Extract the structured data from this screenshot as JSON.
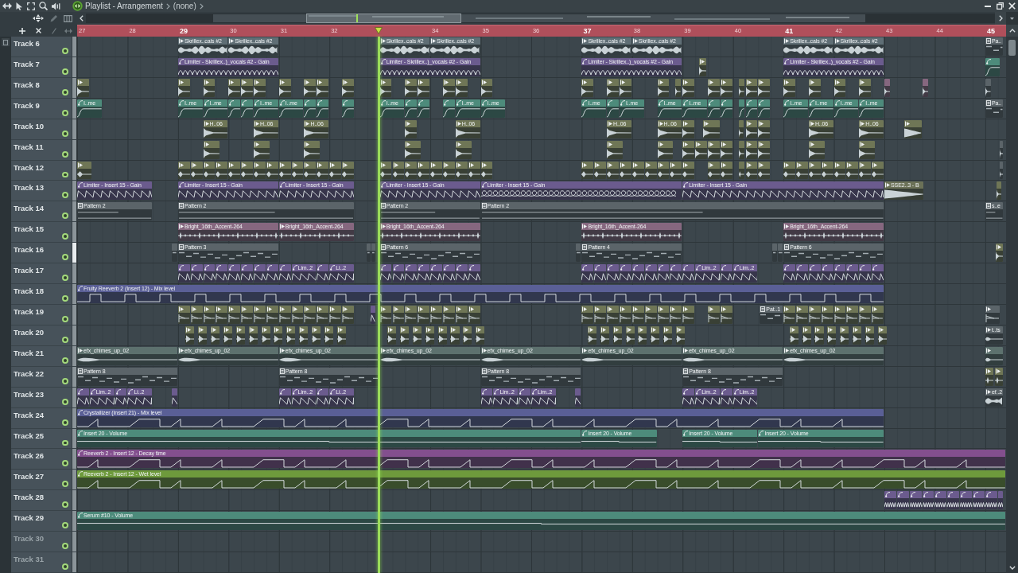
{
  "window": {
    "title": "Playlist - Arrangement",
    "pattern": "(none)"
  },
  "ruler": [
    {
      "label": "27",
      "major": false
    },
    {
      "label": "28",
      "major": false
    },
    {
      "label": "29",
      "major": true
    },
    {
      "label": "30",
      "major": false
    },
    {
      "label": "31",
      "major": false
    },
    {
      "label": "32",
      "major": false
    },
    {
      "label": "34",
      "major": false
    },
    {
      "label": "35",
      "major": false
    },
    {
      "label": "36",
      "major": false
    },
    {
      "label": "37",
      "major": true
    },
    {
      "label": "38",
      "major": false
    },
    {
      "label": "39",
      "major": false
    },
    {
      "label": "40",
      "major": false
    },
    {
      "label": "41",
      "major": true
    },
    {
      "label": "42",
      "major": false
    },
    {
      "label": "43",
      "major": false
    },
    {
      "label": "44",
      "major": false
    },
    {
      "label": "45",
      "major": true
    }
  ],
  "tracks": [
    {
      "name": "Track 6",
      "enabled": true,
      "selected": false,
      "dimmed": false,
      "color": "#5f6e75",
      "clips": [
        {
          "kind": "audio",
          "label": "Skrillex..cals #2"
        },
        {
          "kind": "audio",
          "label": "Skrillex..cals #2"
        },
        {
          "kind": "audio",
          "label": "Skrillex..cals #2"
        },
        {
          "kind": "audio",
          "label": "Skrillex..cals #2"
        },
        {
          "kind": "audio",
          "label": "Skrillex..cals #2"
        },
        {
          "kind": "audio",
          "label": "Skrillex..cals #2"
        },
        {
          "kind": "audio",
          "label": "Skrillex..cals #2"
        },
        {
          "kind": "audio",
          "label": "Skrillex..cals #2"
        },
        {
          "kind": "pattern",
          "label": "Pa..",
          "color": "#5b6469"
        }
      ]
    },
    {
      "name": "Track 7",
      "enabled": true,
      "selected": false,
      "dimmed": false,
      "color": "#6b5b8e",
      "clips": [
        {
          "kind": "automation",
          "label": "Limiter - Skrillex..)_vocals #2 - Gain"
        },
        {
          "kind": "automation",
          "label": "Limiter - Skrillex..)_vocals #2 - Gain"
        },
        {
          "kind": "automation",
          "label": "Limiter - Skrillex..)_vocals #2 - Gain"
        },
        {
          "kind": "audio",
          "color": "#6f7656"
        },
        {
          "kind": "automation",
          "label": "Limiter - Skrillex..)_vocals #2 - Gain"
        },
        {
          "kind": "automation",
          "color": "#4d8b7b"
        }
      ]
    },
    {
      "name": "Track 8",
      "enabled": true,
      "selected": false,
      "dimmed": false,
      "color": "#6f7656",
      "clips": [
        {
          "kind": "audio"
        },
        {
          "kind": "audio"
        },
        {
          "kind": "audio"
        },
        {
          "kind": "audio"
        },
        {
          "kind": "audio"
        },
        {
          "kind": "audio"
        },
        {
          "kind": "audio"
        },
        {
          "kind": "audio"
        },
        {
          "kind": "audio"
        },
        {
          "kind": "audio"
        },
        {
          "kind": "audio"
        },
        {
          "kind": "audio"
        },
        {
          "kind": "audio"
        },
        {
          "kind": "audio"
        },
        {
          "kind": "audio"
        },
        {
          "kind": "audio"
        },
        {
          "kind": "audio"
        },
        {
          "kind": "audio"
        },
        {
          "kind": "audio"
        },
        {
          "kind": "audio"
        },
        {
          "kind": "audio"
        },
        {
          "kind": "audio"
        },
        {
          "kind": "audio"
        },
        {
          "kind": "audio"
        },
        {
          "kind": "audio"
        },
        {
          "kind": "audio"
        },
        {
          "kind": "audio"
        },
        {
          "kind": "audio"
        },
        {
          "kind": "audio"
        },
        {
          "kind": "audio"
        },
        {
          "kind": "audio"
        },
        {
          "kind": "audio",
          "color": "#86677f"
        },
        {
          "kind": "audio",
          "color": "#86677f"
        },
        {
          "kind": "audio",
          "color": "#5b6469"
        }
      ]
    },
    {
      "name": "Track 9",
      "enabled": true,
      "selected": false,
      "dimmed": false,
      "color": "#4d8b7b",
      "clips": [
        {
          "kind": "automation",
          "label": "I..me"
        },
        {
          "kind": "automation",
          "label": "I..me"
        },
        {
          "kind": "automation",
          "label": "I..me"
        },
        {
          "kind": "automation"
        },
        {
          "kind": "automation"
        },
        {
          "kind": "automation",
          "label": "I..me"
        },
        {
          "kind": "automation",
          "label": "I..me"
        },
        {
          "kind": "automation"
        },
        {
          "kind": "automation"
        },
        {
          "kind": "automation"
        },
        {
          "kind": "automation",
          "label": "I..me"
        },
        {
          "kind": "automation"
        },
        {
          "kind": "automation"
        },
        {
          "kind": "automation"
        },
        {
          "kind": "automation",
          "label": "I..me"
        },
        {
          "kind": "automation",
          "label": "I..me"
        },
        {
          "kind": "automation",
          "label": "I..me"
        },
        {
          "kind": "automation"
        },
        {
          "kind": "automation",
          "label": "I..me"
        },
        {
          "kind": "automation",
          "label": "I..me"
        },
        {
          "kind": "automation",
          "label": "I..me"
        },
        {
          "kind": "automation"
        },
        {
          "kind": "automation"
        },
        {
          "kind": "automation"
        },
        {
          "kind": "automation"
        },
        {
          "kind": "automation"
        },
        {
          "kind": "automation",
          "label": "I..me"
        },
        {
          "kind": "automation",
          "label": "I..me"
        },
        {
          "kind": "automation",
          "label": "I..me"
        },
        {
          "kind": "automation",
          "label": "I..me"
        },
        {
          "kind": "pattern",
          "label": "Pa..",
          "color": "#5b6469"
        }
      ]
    },
    {
      "name": "Track 10",
      "enabled": true,
      "selected": false,
      "dimmed": false,
      "color": "#6f7656",
      "clips": [
        {
          "kind": "audio",
          "label": "H..06"
        },
        {
          "kind": "audio",
          "label": "H..06"
        },
        {
          "kind": "audio",
          "label": "H..06"
        },
        {
          "kind": "audio"
        },
        {
          "kind": "audio",
          "label": "H..06"
        },
        {
          "kind": "audio",
          "label": "H..06"
        },
        {
          "kind": "audio",
          "label": "H..06"
        },
        {
          "kind": "audio"
        },
        {
          "kind": "audio"
        },
        {
          "kind": "audio"
        },
        {
          "kind": "audio"
        },
        {
          "kind": "audio"
        },
        {
          "kind": "audio",
          "label": "H..06"
        },
        {
          "kind": "audio",
          "label": "H..06"
        },
        {
          "kind": "audio"
        }
      ]
    },
    {
      "name": "Track 11",
      "enabled": true,
      "selected": false,
      "dimmed": false,
      "color": "#6f7656",
      "clips": [
        {
          "kind": "audio"
        },
        {
          "kind": "audio"
        },
        {
          "kind": "audio"
        },
        {
          "kind": "audio"
        },
        {
          "kind": "audio"
        },
        {
          "kind": "audio"
        },
        {
          "kind": "audio"
        },
        {
          "kind": "audio"
        },
        {
          "kind": "audio"
        },
        {
          "kind": "audio"
        },
        {
          "kind": "audio"
        },
        {
          "kind": "audio"
        },
        {
          "kind": "audio"
        },
        {
          "kind": "audio"
        },
        {
          "kind": "audio"
        },
        {
          "kind": "audio"
        },
        {
          "kind": "audio",
          "color": "#5b6469"
        }
      ]
    },
    {
      "name": "Track 12",
      "enabled": true,
      "selected": false,
      "dimmed": false,
      "color": "#6f7656",
      "clips": [
        {
          "kind": "audio"
        },
        {
          "kind": "audio"
        },
        {
          "kind": "audio"
        },
        {
          "kind": "audio"
        },
        {
          "kind": "audio"
        },
        {
          "kind": "audio"
        },
        {
          "kind": "audio"
        },
        {
          "kind": "audio"
        },
        {
          "kind": "audio"
        },
        {
          "kind": "audio"
        },
        {
          "kind": "audio"
        },
        {
          "kind": "audio"
        },
        {
          "kind": "audio"
        },
        {
          "kind": "audio"
        },
        {
          "kind": "audio"
        },
        {
          "kind": "audio"
        },
        {
          "kind": "audio"
        },
        {
          "kind": "audio"
        },
        {
          "kind": "audio"
        },
        {
          "kind": "audio"
        },
        {
          "kind": "audio"
        },
        {
          "kind": "audio"
        },
        {
          "kind": "audio"
        },
        {
          "kind": "audio"
        },
        {
          "kind": "audio"
        },
        {
          "kind": "audio"
        },
        {
          "kind": "audio"
        },
        {
          "kind": "audio"
        },
        {
          "kind": "audio"
        },
        {
          "kind": "audio"
        },
        {
          "kind": "audio"
        },
        {
          "kind": "audio"
        },
        {
          "kind": "audio"
        },
        {
          "kind": "audio"
        },
        {
          "kind": "audio"
        },
        {
          "kind": "audio"
        },
        {
          "kind": "audio"
        },
        {
          "kind": "audio"
        },
        {
          "kind": "audio"
        },
        {
          "kind": "audio"
        },
        {
          "kind": "audio"
        },
        {
          "kind": "audio"
        },
        {
          "kind": "audio"
        },
        {
          "kind": "audio"
        },
        {
          "kind": "audio"
        },
        {
          "kind": "audio"
        },
        {
          "kind": "audio",
          "color": "#5b6469"
        }
      ]
    },
    {
      "name": "Track 13",
      "enabled": true,
      "selected": false,
      "dimmed": false,
      "color": "#6b5b8e",
      "clips": [
        {
          "kind": "automation",
          "label": "Limiter - Insert 15 - Gain"
        },
        {
          "kind": "automation",
          "label": "Limiter - Insert 15 - Gain"
        },
        {
          "kind": "automation",
          "label": "Limiter - Insert 15 - Gain"
        },
        {
          "kind": "automation",
          "label": "Limiter - Insert 15 - Gain"
        },
        {
          "kind": "automation",
          "label": "Limiter - Insert 15 - Gain"
        },
        {
          "kind": "automation",
          "label": "Limiter - Insert 15 - Gain"
        },
        {
          "kind": "audio",
          "label": "SSE2..3 - B",
          "color": "#6b7157"
        },
        {
          "kind": "audio",
          "color": "#6f7656"
        }
      ]
    },
    {
      "name": "Track 14",
      "enabled": true,
      "selected": false,
      "dimmed": false,
      "color": "#5b6469",
      "clips": [
        {
          "kind": "pattern",
          "label": "Pattern 2"
        },
        {
          "kind": "pattern",
          "label": "Pattern 2"
        },
        {
          "kind": "pattern",
          "label": "Pattern 2"
        },
        {
          "kind": "pattern",
          "label": "Pattern 2"
        },
        {
          "kind": "pattern",
          "label": "s..e"
        }
      ]
    },
    {
      "name": "Track 15",
      "enabled": true,
      "selected": false,
      "dimmed": false,
      "color": "#86677f",
      "clips": [
        {
          "kind": "audio",
          "label": "Bright_16th_Accent-264"
        },
        {
          "kind": "audio",
          "label": "Bright_16th_Accent-264"
        },
        {
          "kind": "audio",
          "label": "Bright_16th_Accent-264"
        },
        {
          "kind": "audio",
          "label": "Bright_16th_Accent-264"
        },
        {
          "kind": "audio",
          "label": "Bright_16th_Accent-264"
        }
      ]
    },
    {
      "name": "Track 16",
      "enabled": true,
      "selected": true,
      "dimmed": false,
      "color": "#5b6469",
      "clips": [
        {
          "kind": "pattern"
        },
        {
          "kind": "pattern",
          "label": "Pattern 3"
        },
        {
          "kind": "pattern"
        },
        {
          "kind": "pattern"
        },
        {
          "kind": "pattern",
          "label": "Pattern 6"
        },
        {
          "kind": "pattern"
        },
        {
          "kind": "pattern",
          "label": "Pattern 4"
        },
        {
          "kind": "pattern"
        },
        {
          "kind": "pattern"
        },
        {
          "kind": "pattern",
          "label": "Pattern 6"
        },
        {
          "kind": "audio",
          "color": "#6f7656"
        }
      ]
    },
    {
      "name": "Track 17",
      "enabled": true,
      "selected": false,
      "dimmed": false,
      "color": "#6b5b8e",
      "clips": [
        {
          "kind": "automation"
        },
        {
          "kind": "automation"
        },
        {
          "kind": "automation"
        },
        {
          "kind": "automation"
        },
        {
          "kind": "automation"
        },
        {
          "kind": "automation"
        },
        {
          "kind": "automation"
        },
        {
          "kind": "automation"
        },
        {
          "kind": "automation"
        },
        {
          "kind": "automation",
          "label": "Lim..2"
        },
        {
          "kind": "automation"
        },
        {
          "kind": "automation",
          "label": "Li..2"
        },
        {
          "kind": "automation"
        },
        {
          "kind": "automation"
        },
        {
          "kind": "automation"
        },
        {
          "kind": "automation"
        },
        {
          "kind": "automation"
        },
        {
          "kind": "automation"
        },
        {
          "kind": "automation"
        },
        {
          "kind": "automation"
        },
        {
          "kind": "automation"
        },
        {
          "kind": "automation"
        },
        {
          "kind": "automation"
        },
        {
          "kind": "automation"
        },
        {
          "kind": "automation"
        },
        {
          "kind": "automation"
        },
        {
          "kind": "automation"
        },
        {
          "kind": "automation"
        },
        {
          "kind": "automation"
        },
        {
          "kind": "automation",
          "label": "Lim..2"
        },
        {
          "kind": "automation"
        },
        {
          "kind": "automation",
          "label": "Lim..2"
        },
        {
          "kind": "automation"
        },
        {
          "kind": "automation"
        },
        {
          "kind": "automation"
        },
        {
          "kind": "automation"
        },
        {
          "kind": "automation"
        },
        {
          "kind": "automation"
        },
        {
          "kind": "automation"
        },
        {
          "kind": "automation"
        }
      ]
    },
    {
      "name": "Track 18",
      "enabled": true,
      "selected": false,
      "dimmed": false,
      "color": "#5a5f96",
      "clips": [
        {
          "kind": "automation",
          "label": "Fruity Reeverb 2 (Insert 12) - Mix level"
        }
      ]
    },
    {
      "name": "Track 19",
      "enabled": true,
      "selected": false,
      "dimmed": false,
      "color": "#6f7656",
      "clips": [
        {
          "kind": "audio"
        },
        {
          "kind": "audio"
        },
        {
          "kind": "audio"
        },
        {
          "kind": "audio"
        },
        {
          "kind": "audio"
        },
        {
          "kind": "audio"
        },
        {
          "kind": "audio"
        },
        {
          "kind": "audio"
        },
        {
          "kind": "audio"
        },
        {
          "kind": "audio"
        },
        {
          "kind": "audio"
        },
        {
          "kind": "audio"
        },
        {
          "kind": "audio"
        },
        {
          "kind": "audio"
        },
        {
          "kind": "automation",
          "color": "#6b5b8e"
        },
        {
          "kind": "audio"
        },
        {
          "kind": "audio"
        },
        {
          "kind": "audio"
        },
        {
          "kind": "audio"
        },
        {
          "kind": "audio"
        },
        {
          "kind": "audio"
        },
        {
          "kind": "audio"
        },
        {
          "kind": "audio"
        },
        {
          "kind": "audio"
        },
        {
          "kind": "audio"
        },
        {
          "kind": "audio"
        },
        {
          "kind": "audio"
        },
        {
          "kind": "audio"
        },
        {
          "kind": "audio"
        },
        {
          "kind": "audio"
        },
        {
          "kind": "audio"
        },
        {
          "kind": "audio"
        },
        {
          "kind": "audio"
        },
        {
          "kind": "audio"
        },
        {
          "kind": "pattern",
          "label": "Pat..1",
          "color": "#5b6469"
        },
        {
          "kind": "audio"
        },
        {
          "kind": "audio"
        },
        {
          "kind": "audio"
        },
        {
          "kind": "audio"
        },
        {
          "kind": "audio"
        },
        {
          "kind": "audio"
        },
        {
          "kind": "audio"
        },
        {
          "kind": "audio"
        },
        {
          "kind": "audio",
          "color": "#5b6469"
        }
      ]
    },
    {
      "name": "Track 20",
      "enabled": true,
      "selected": false,
      "dimmed": false,
      "color": "#6f7656",
      "clips": [
        {
          "kind": "audio"
        },
        {
          "kind": "audio"
        },
        {
          "kind": "audio"
        },
        {
          "kind": "audio"
        },
        {
          "kind": "audio"
        },
        {
          "kind": "audio"
        },
        {
          "kind": "audio"
        },
        {
          "kind": "audio"
        },
        {
          "kind": "audio"
        },
        {
          "kind": "audio"
        },
        {
          "kind": "audio"
        },
        {
          "kind": "audio"
        },
        {
          "kind": "audio"
        },
        {
          "kind": "audio"
        },
        {
          "kind": "audio"
        },
        {
          "kind": "audio"
        },
        {
          "kind": "audio"
        },
        {
          "kind": "audio"
        },
        {
          "kind": "audio"
        },
        {
          "kind": "audio"
        },
        {
          "kind": "audio"
        },
        {
          "kind": "audio"
        },
        {
          "kind": "audio"
        },
        {
          "kind": "audio"
        },
        {
          "kind": "audio"
        },
        {
          "kind": "audio"
        },
        {
          "kind": "audio"
        },
        {
          "kind": "audio"
        },
        {
          "kind": "audio"
        },
        {
          "kind": "audio"
        },
        {
          "kind": "audio"
        },
        {
          "kind": "audio"
        },
        {
          "kind": "audio"
        },
        {
          "kind": "audio"
        },
        {
          "kind": "audio"
        },
        {
          "kind": "audio"
        },
        {
          "kind": "audio"
        },
        {
          "kind": "audio",
          "label": "t..ts",
          "color": "#5b6469"
        }
      ]
    },
    {
      "name": "Track 21",
      "enabled": true,
      "selected": false,
      "dimmed": false,
      "color": "#5d716e",
      "clips": [
        {
          "kind": "audio",
          "label": "efx_chimes_up_02"
        },
        {
          "kind": "audio",
          "label": "efx_chimes_up_02"
        },
        {
          "kind": "audio",
          "label": "efx_chimes_up_02"
        },
        {
          "kind": "audio",
          "label": "efx_chimes_up_02"
        },
        {
          "kind": "audio",
          "label": "efx_chimes_up_02"
        },
        {
          "kind": "audio",
          "label": "efx_chimes_up_02"
        },
        {
          "kind": "audio",
          "label": "efx_chimes_up_02"
        },
        {
          "kind": "audio",
          "label": "efx_chimes_up_02"
        },
        {
          "kind": "audio"
        }
      ]
    },
    {
      "name": "Track 22",
      "enabled": true,
      "selected": false,
      "dimmed": false,
      "color": "#5b6469",
      "clips": [
        {
          "kind": "pattern",
          "label": "Pattern 8"
        },
        {
          "kind": "pattern",
          "label": "Pattern 8"
        },
        {
          "kind": "pattern",
          "label": "Pattern 8"
        },
        {
          "kind": "pattern",
          "label": "Pattern 8"
        },
        {
          "kind": "audio",
          "color": "#6f7656"
        },
        {
          "kind": "audio",
          "color": "#6f7656"
        }
      ]
    },
    {
      "name": "Track 23",
      "enabled": true,
      "selected": false,
      "dimmed": false,
      "color": "#6b5b8e",
      "clips": [
        {
          "kind": "automation"
        },
        {
          "kind": "automation",
          "label": "Lim..2"
        },
        {
          "kind": "automation"
        },
        {
          "kind": "automation",
          "label": "Li..2"
        },
        {
          "kind": "automation"
        },
        {
          "kind": "automation"
        },
        {
          "kind": "automation",
          "label": "Lim..2"
        },
        {
          "kind": "automation"
        },
        {
          "kind": "automation",
          "label": "Li..2"
        },
        {
          "kind": "automation"
        },
        {
          "kind": "automation",
          "label": "Lim..2"
        },
        {
          "kind": "automation"
        },
        {
          "kind": "automation",
          "label": "Lim..2"
        },
        {
          "kind": "automation"
        },
        {
          "kind": "automation"
        },
        {
          "kind": "automation",
          "label": "Lim..2"
        },
        {
          "kind": "automation"
        },
        {
          "kind": "automation",
          "label": "Lim..2"
        },
        {
          "kind": "audio",
          "label": "ef..2",
          "color": "#5b6469"
        }
      ]
    },
    {
      "name": "Track 24",
      "enabled": true,
      "selected": false,
      "dimmed": false,
      "color": "#5a5f96",
      "clips": [
        {
          "kind": "automation",
          "label": "Crystallizer (Insert 21) - Mix level"
        }
      ]
    },
    {
      "name": "Track 25",
      "enabled": true,
      "selected": false,
      "dimmed": false,
      "color": "#4d8b7b",
      "clips": [
        {
          "kind": "automation",
          "label": "Insert 20 - Volume"
        },
        {
          "kind": "automation",
          "label": "Insert 20 - Volume"
        },
        {
          "kind": "automation",
          "label": "Insert 20 - Volume"
        },
        {
          "kind": "automation",
          "label": "Insert 20 - Volume"
        }
      ]
    },
    {
      "name": "Track 26",
      "enabled": true,
      "selected": false,
      "dimmed": false,
      "color": "#834f8e",
      "clips": [
        {
          "kind": "automation",
          "label": "Reeverb 2 - Insert 12 - Decay time"
        }
      ]
    },
    {
      "name": "Track 27",
      "enabled": true,
      "selected": false,
      "dimmed": false,
      "color": "#6e9a3c",
      "clips": [
        {
          "kind": "automation",
          "label": "Reeverb 2 - Insert 12 - Wet level"
        }
      ]
    },
    {
      "name": "Track 28",
      "enabled": true,
      "selected": false,
      "dimmed": false,
      "color": "#6b5b8e",
      "clips": [
        {
          "kind": "automation"
        },
        {
          "kind": "automation"
        },
        {
          "kind": "automation"
        },
        {
          "kind": "automation"
        },
        {
          "kind": "automation"
        },
        {
          "kind": "automation"
        },
        {
          "kind": "automation"
        },
        {
          "kind": "automation"
        },
        {
          "kind": "automation"
        },
        {
          "kind": "automation"
        }
      ]
    },
    {
      "name": "Track 29",
      "enabled": true,
      "selected": false,
      "dimmed": false,
      "color": "#4d8b7b",
      "clips": [
        {
          "kind": "automation",
          "label": "Serum #10 - Volume"
        }
      ]
    },
    {
      "name": "Track 30",
      "enabled": true,
      "selected": false,
      "dimmed": true
    },
    {
      "name": "Track 31",
      "enabled": true,
      "selected": false,
      "dimmed": true
    }
  ]
}
